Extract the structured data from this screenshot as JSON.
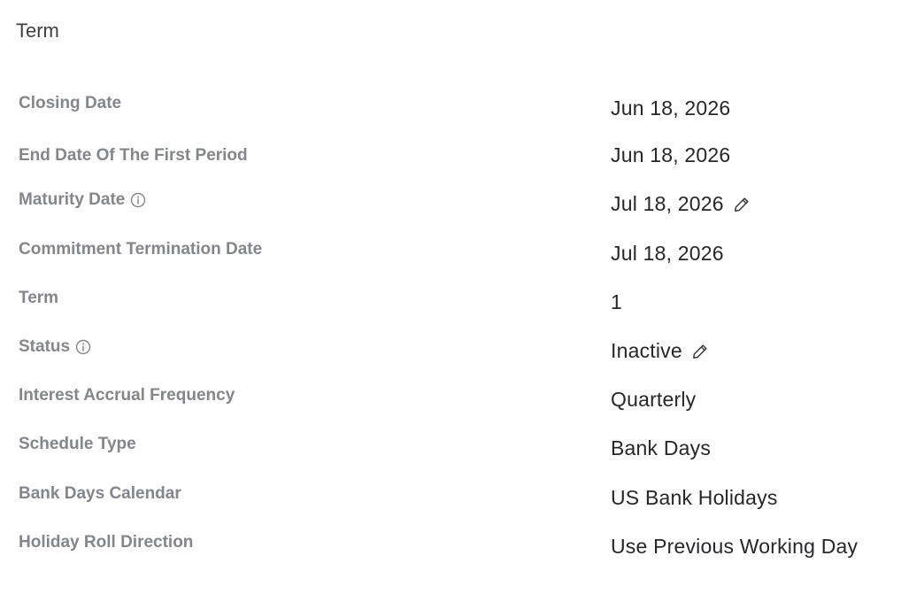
{
  "section": {
    "title": "Term"
  },
  "fields": [
    {
      "label": "Closing Date",
      "value": "Jun 18, 2026"
    },
    {
      "label": "End Date Of The First Period",
      "value": "Jun 18, 2026"
    },
    {
      "label": "Maturity Date",
      "value": "Jul 18, 2026",
      "label_icon": "info-icon",
      "value_icon": "pencil-edit-icon"
    },
    {
      "label": "Commitment Termination Date",
      "value": "Jul 18, 2026"
    },
    {
      "label": "Term",
      "value": "1"
    },
    {
      "label": "Status",
      "value": "Inactive",
      "label_icon": "info-icon",
      "value_icon": "pencil-edit-icon"
    },
    {
      "label": "Interest Accrual Frequency",
      "value": "Quarterly"
    },
    {
      "label": "Schedule Type",
      "value": "Bank Days"
    },
    {
      "label": "Bank Days Calendar",
      "value": "US Bank Holidays"
    },
    {
      "label": "Holiday Roll Direction",
      "value": "Use Previous Working Day"
    }
  ],
  "colors": {
    "label": "#84868c",
    "value": "#26272b",
    "title": "#3f4044",
    "icon": "#3a3b3f"
  }
}
